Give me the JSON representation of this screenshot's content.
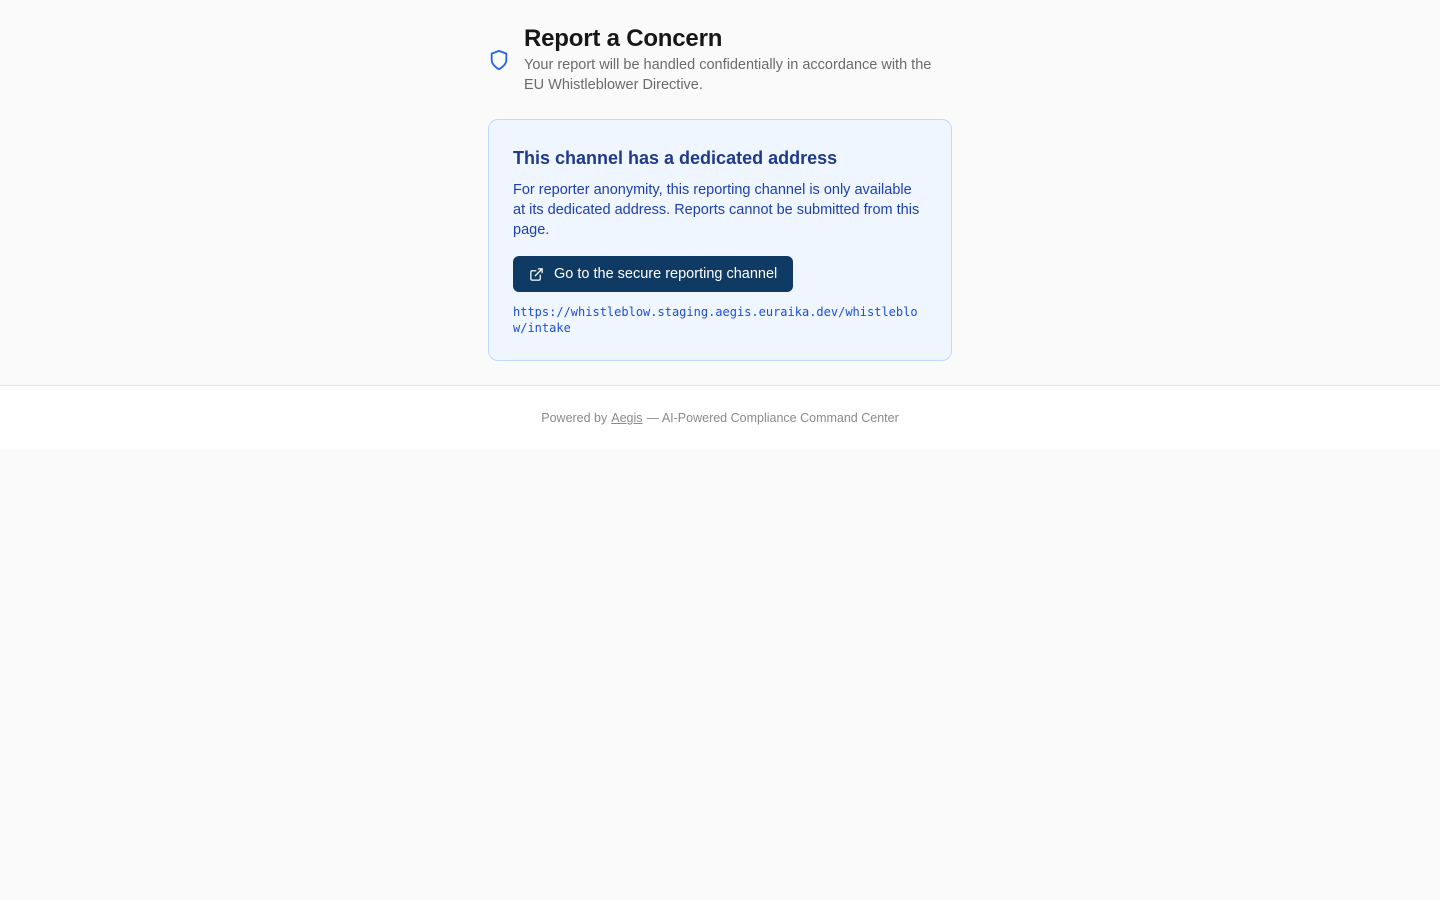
{
  "header": {
    "title": "Report a Concern",
    "subtitle": "Your report will be handled confidentially in accordance with the EU Whistleblower Directive.",
    "icon": "shield-icon"
  },
  "notice": {
    "title": "This channel has a dedicated address",
    "text": "For reporter anonymity, this reporting channel is only available at its dedicated address. Reports cannot be submitted from this page.",
    "button_label": "Go to the secure reporting channel",
    "button_icon": "external-link-icon",
    "url": "https://whistleblow.staging.aegis.euraika.dev/whistleblow/intake"
  },
  "footer": {
    "prefix": "Powered by",
    "link_text": "Aegis",
    "suffix": "— AI-Powered Compliance Command Center"
  },
  "colors": {
    "accent": "#2563eb",
    "button": "#0f3a63",
    "notice_bg": "#eff6ff",
    "notice_border": "#bfdbfe",
    "notice_title": "#1e3a8a"
  }
}
